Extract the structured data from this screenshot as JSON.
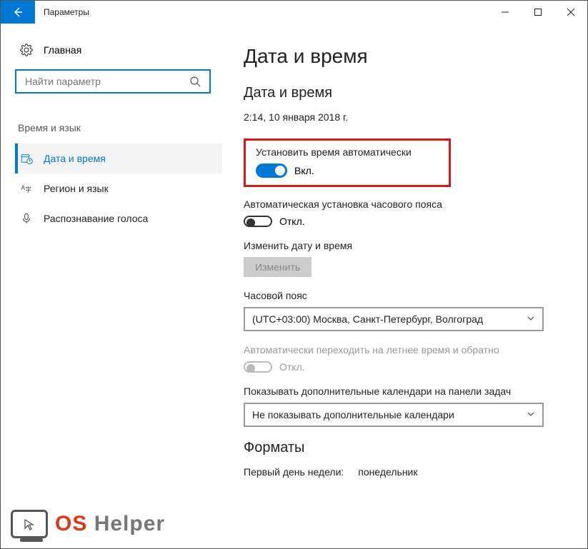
{
  "titlebar": {
    "title": "Параметры"
  },
  "sidebar": {
    "home_label": "Главная",
    "search_placeholder": "Найти параметр",
    "section_heading": "Время и язык",
    "items": [
      {
        "label": "Дата и время"
      },
      {
        "label": "Регион и язык"
      },
      {
        "label": "Распознавание голоса"
      }
    ]
  },
  "main": {
    "page_title": "Дата и время",
    "section_title": "Дата и время",
    "current_datetime": "2:14, 10 января 2018 г.",
    "auto_time": {
      "label": "Установить время автоматически",
      "state": "Вкл."
    },
    "auto_tz": {
      "label": "Автоматическая установка часового пояса",
      "state": "Откл."
    },
    "change_dt": {
      "label": "Изменить дату и время",
      "button": "Изменить"
    },
    "timezone": {
      "label": "Часовой пояс",
      "value": "(UTC+03:00) Москва, Санкт-Петербург, Волгоград"
    },
    "dst": {
      "label": "Автоматически переходить на летнее время и обратно",
      "state": "Откл."
    },
    "extra_cal": {
      "label": "Показывать дополнительные календари на панели задач",
      "value": "Не показывать дополнительные календари"
    },
    "formats": {
      "title": "Форматы",
      "first_day_label": "Первый день недели:",
      "first_day_value": "понедельник"
    }
  },
  "watermark": {
    "os": "OS",
    "helper": "Helper"
  }
}
